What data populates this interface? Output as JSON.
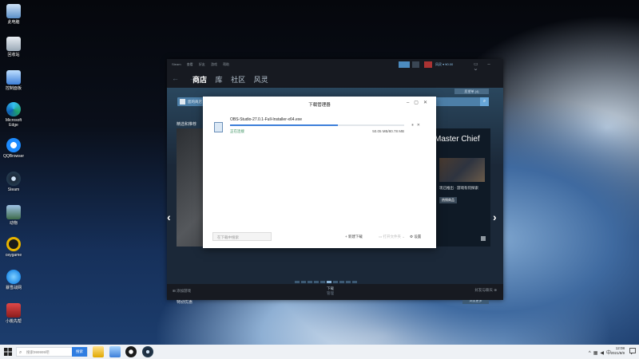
{
  "desktop": {
    "icons": [
      {
        "label": "此电脑"
      },
      {
        "label": "回收站"
      },
      {
        "label": "控制面板"
      },
      {
        "label": "Microsoft Edge"
      },
      {
        "label": "QQBrowser"
      },
      {
        "label": "Steam"
      },
      {
        "label": "动物"
      },
      {
        "label": "oxygame"
      },
      {
        "label": "暴雪战网"
      },
      {
        "label": "小桃先帮"
      }
    ]
  },
  "steam": {
    "menu": [
      "Steam",
      "查看",
      "好友",
      "游戏",
      "帮助"
    ],
    "nav_back": "←",
    "nav_forward": "→",
    "tabs": [
      {
        "label": "商店",
        "active": true
      },
      {
        "label": "库",
        "active": false
      },
      {
        "label": "社区",
        "active": false
      },
      {
        "label": "风灵",
        "active": false
      }
    ],
    "user_label": "风灵 ▾ ¥0.00",
    "wishlist_label": "愿望单 (4)",
    "search_placeholder": "您的商店",
    "featured_label": "精选和推荐",
    "featured_title": "Master Chief",
    "featured_desc": "现已推出 · 游戏有何探索",
    "featured_tag": "热销商品",
    "special_offers_label": "特别优惠",
    "browse_more": "浏览更多",
    "add_game": "添加游戏",
    "downloads_label": "下载",
    "downloads_sub": "管理",
    "friends_chat": "好友与聊天",
    "carousel_dots": 10,
    "active_dot": 5
  },
  "download_manager": {
    "title": "下载管理器",
    "file_name": "OBS-Studio-27.0.1-Full-Installer-x64.exe",
    "progress_percent": 62,
    "status": "正在连接",
    "size_text": "50.05 MB/80.78 MB",
    "search_placeholder": "在下载中搜索",
    "new_download": "新建下载",
    "open_folder": "打开文件夹",
    "settings": "设置"
  },
  "taskbar": {
    "search_placeholder": "搜索999999吧",
    "search_button": "搜索",
    "time": "12:08",
    "date": "2021/8/9"
  }
}
